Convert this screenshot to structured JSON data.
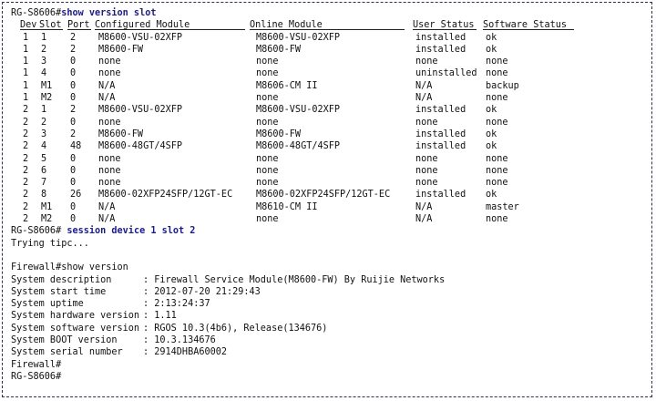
{
  "prompt_main": "RG-S8606#",
  "cmd_show_slot": "show version slot",
  "headers": [
    "Dev",
    "Slot",
    "Port",
    "Configured Module",
    "Online Module",
    "User Status",
    "Software Status"
  ],
  "rows": [
    [
      "1",
      "1",
      "2",
      "M8600-VSU-02XFP",
      "M8600-VSU-02XFP",
      "installed",
      "ok"
    ],
    [
      "1",
      "2",
      "2",
      "M8600-FW",
      "M8600-FW",
      "installed",
      "ok"
    ],
    [
      "1",
      "3",
      "0",
      "none",
      "none",
      "none",
      "none"
    ],
    [
      "1",
      "4",
      "0",
      "none",
      "none",
      "uninstalled",
      "none"
    ],
    [
      "1",
      "M1",
      "0",
      "N/A",
      "M8606-CM II",
      "N/A",
      "backup"
    ],
    [
      "1",
      "M2",
      "0",
      "N/A",
      "none",
      "N/A",
      "none"
    ],
    [
      "2",
      "1",
      "2",
      "M8600-VSU-02XFP",
      "M8600-VSU-02XFP",
      "installed",
      "ok"
    ],
    [
      "2",
      "2",
      "0",
      "none",
      "none",
      "none",
      "none"
    ],
    [
      "2",
      "3",
      "2",
      "M8600-FW",
      "M8600-FW",
      "installed",
      "ok"
    ],
    [
      "2",
      "4",
      "48",
      "M8600-48GT/4SFP",
      "M8600-48GT/4SFP",
      "installed",
      "ok"
    ],
    [
      "2",
      "5",
      "0",
      "none",
      "none",
      "none",
      "none"
    ],
    [
      "2",
      "6",
      "0",
      "none",
      "none",
      "none",
      "none"
    ],
    [
      "2",
      "7",
      "0",
      "none",
      "none",
      "none",
      "none"
    ],
    [
      "2",
      "8",
      "26",
      "M8600-02XFP24SFP/12GT-EC",
      "M8600-02XFP24SFP/12GT-EC",
      "installed",
      "ok"
    ],
    [
      "2",
      "M1",
      "0",
      "N/A",
      "M8610-CM II",
      "N/A",
      "master"
    ],
    [
      "2",
      "M2",
      "0",
      "N/A",
      "none",
      "N/A",
      "none"
    ]
  ],
  "cmd_session": "session device 1 slot 2",
  "trying": "Trying tipc...",
  "fw_show_version": "Firewall#show version",
  "sysinfo": [
    [
      "System description",
      ": Firewall Service Module(M8600-FW) By Ruijie Networks"
    ],
    [
      "System start time",
      ": 2012-07-20 21:29:43"
    ],
    [
      "System uptime",
      ": 2:13:24:37"
    ],
    [
      "System hardware version",
      ": 1.11"
    ],
    [
      "System software version",
      ": RGOS 10.3(4b6), Release(134676)"
    ],
    [
      "System BOOT version",
      ": 10.3.134676"
    ],
    [
      "System serial number",
      ": 2914DHBA60002"
    ]
  ],
  "fw_prompt": "Firewall#",
  "final_prompt": "RG-S8606#"
}
